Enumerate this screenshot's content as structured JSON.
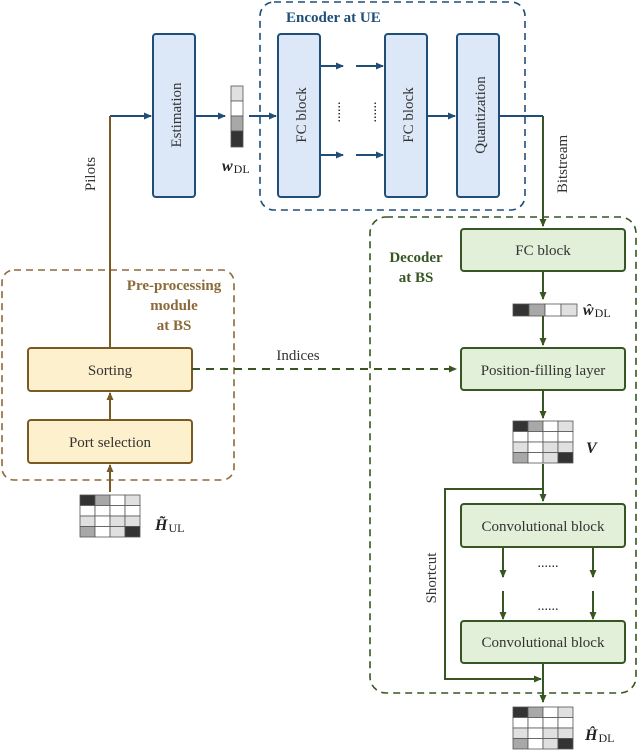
{
  "encoder": {
    "title": "Encoder at UE",
    "estimation_label": "Estimation",
    "fc_block_1_label": "FC block",
    "fc_block_2_label": "FC block",
    "quantization_label": "Quantization",
    "ellipsis": "......"
  },
  "preprocessing": {
    "title_line1": "Pre-processing",
    "title_line2": "module",
    "title_line3": "at BS",
    "sorting_label": "Sorting",
    "port_selection_label": "Port selection"
  },
  "decoder": {
    "title_line1": "Decoder",
    "title_line2": "at BS",
    "fc_block_label": "FC block",
    "position_filling_label": "Position-filling layer",
    "conv_block_1_label": "Convolutional block",
    "conv_block_2_label": "Convolutional block",
    "ellipsis": "......"
  },
  "connections": {
    "pilots_label": "Pilots",
    "bitstream_label": "Bitstream",
    "indices_label": "Indices",
    "shortcut_label": "Shortcut"
  },
  "variables": {
    "w_dl": {
      "symbol": "w",
      "subscript": "DL"
    },
    "w_hat_dl": {
      "symbol": "ŵ",
      "subscript": "DL"
    },
    "v": {
      "symbol": "V"
    },
    "h_tilde_ul": {
      "symbol": "H̃",
      "subscript": "UL"
    },
    "h_hat_dl": {
      "symbol": "Ĥ",
      "subscript": "DL"
    }
  },
  "colors": {
    "encoder": "#1f4e79",
    "preprocessing": "#8a6a3a",
    "decoder": "#375623",
    "encoder_fill": "#dce8f7",
    "preprocessing_fill": "#fdf0cc",
    "decoder_fill": "#e2efd9"
  }
}
